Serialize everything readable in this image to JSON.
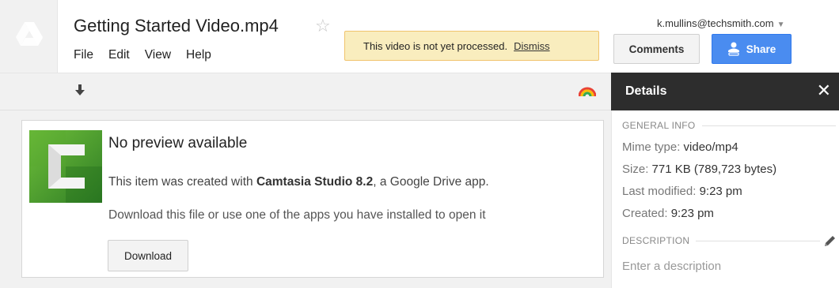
{
  "header": {
    "file_title": "Getting Started Video.mp4",
    "star_icon": "star-outline-icon",
    "menu": [
      "File",
      "Edit",
      "View",
      "Help"
    ],
    "notice_text": "This video is not yet processed.",
    "notice_dismiss": "Dismiss",
    "account_email": "k.mullins@techsmith.com",
    "comments_label": "Comments",
    "share_label": "Share"
  },
  "toolbar": {
    "download_icon": "download-arrow-icon",
    "apps_icon": "rainbow-icon"
  },
  "preview": {
    "title": "No preview available",
    "line1_prefix": "This item was created with ",
    "line1_app": "Camtasia Studio 8.2",
    "line1_suffix": ", a Google Drive app.",
    "line2": "Download this file or use one of the apps you have installed to open it",
    "download_label": "Download"
  },
  "details": {
    "title": "Details",
    "close": "✕",
    "general_info_label": "GENERAL INFO",
    "mime_key": "Mime type",
    "mime_val": "video/mp4",
    "size_key": "Size",
    "size_val": "771 KB (789,723 bytes)",
    "modified_key": "Last modified",
    "modified_val": "9:23 pm",
    "created_key": "Created",
    "created_val": "9:23 pm",
    "description_label": "DESCRIPTION",
    "description_placeholder": "Enter a description"
  },
  "colors": {
    "share_blue": "#4a8cf0",
    "notice_yellow": "#f9edbe",
    "details_dark": "#2d2d2d"
  }
}
